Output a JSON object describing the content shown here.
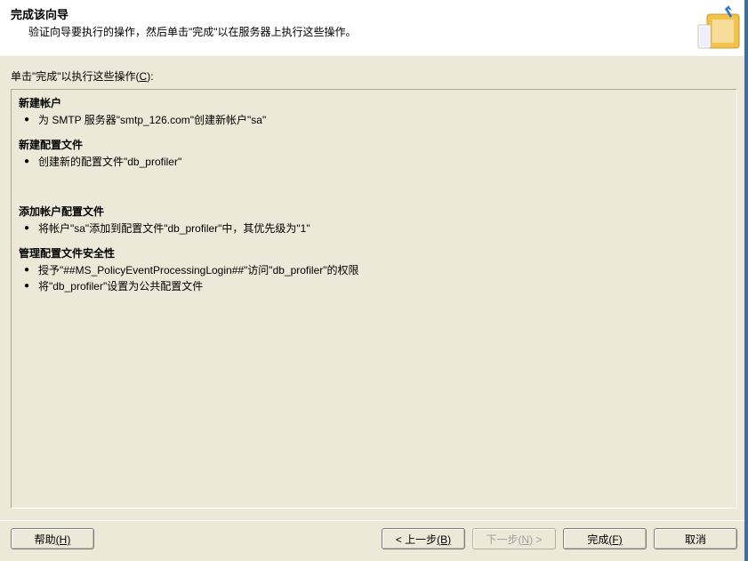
{
  "header": {
    "title": "完成该向导",
    "subtitle": "验证向导要执行的操作，然后单击\"完成\"以在服务器上执行这些操作。"
  },
  "instruction": {
    "prefix": "单击\"完成\"以执行这些操作(",
    "mnemonic": "C",
    "suffix": "):"
  },
  "sections": [
    {
      "title": "新建帐户",
      "items": [
        "为 SMTP 服务器\"smtp_126.com\"创建新帐户\"sa\""
      ]
    },
    {
      "title": "新建配置文件",
      "items": [
        "创建新的配置文件\"db_profiler\""
      ]
    },
    {
      "title": "添加帐户配置文件",
      "items": [
        "将帐户\"sa\"添加到配置文件\"db_profiler\"中，其优先级为\"1\""
      ],
      "gap_before": true
    },
    {
      "title": "管理配置文件安全性",
      "items": [
        "授予\"##MS_PolicyEventProcessingLogin##\"访问\"db_profiler\"的权限",
        "将\"db_profiler\"设置为公共配置文件"
      ]
    }
  ],
  "buttons": {
    "help": {
      "label": "帮助",
      "mnemonic": "(H)"
    },
    "back": {
      "label": "< 上一步",
      "mnemonic": "(B)"
    },
    "next": {
      "label": "下一步",
      "mnemonic": "(N)",
      "suffix": " >"
    },
    "finish": {
      "label": "完成",
      "mnemonic": "(F)"
    },
    "cancel": {
      "label": "取消"
    }
  }
}
